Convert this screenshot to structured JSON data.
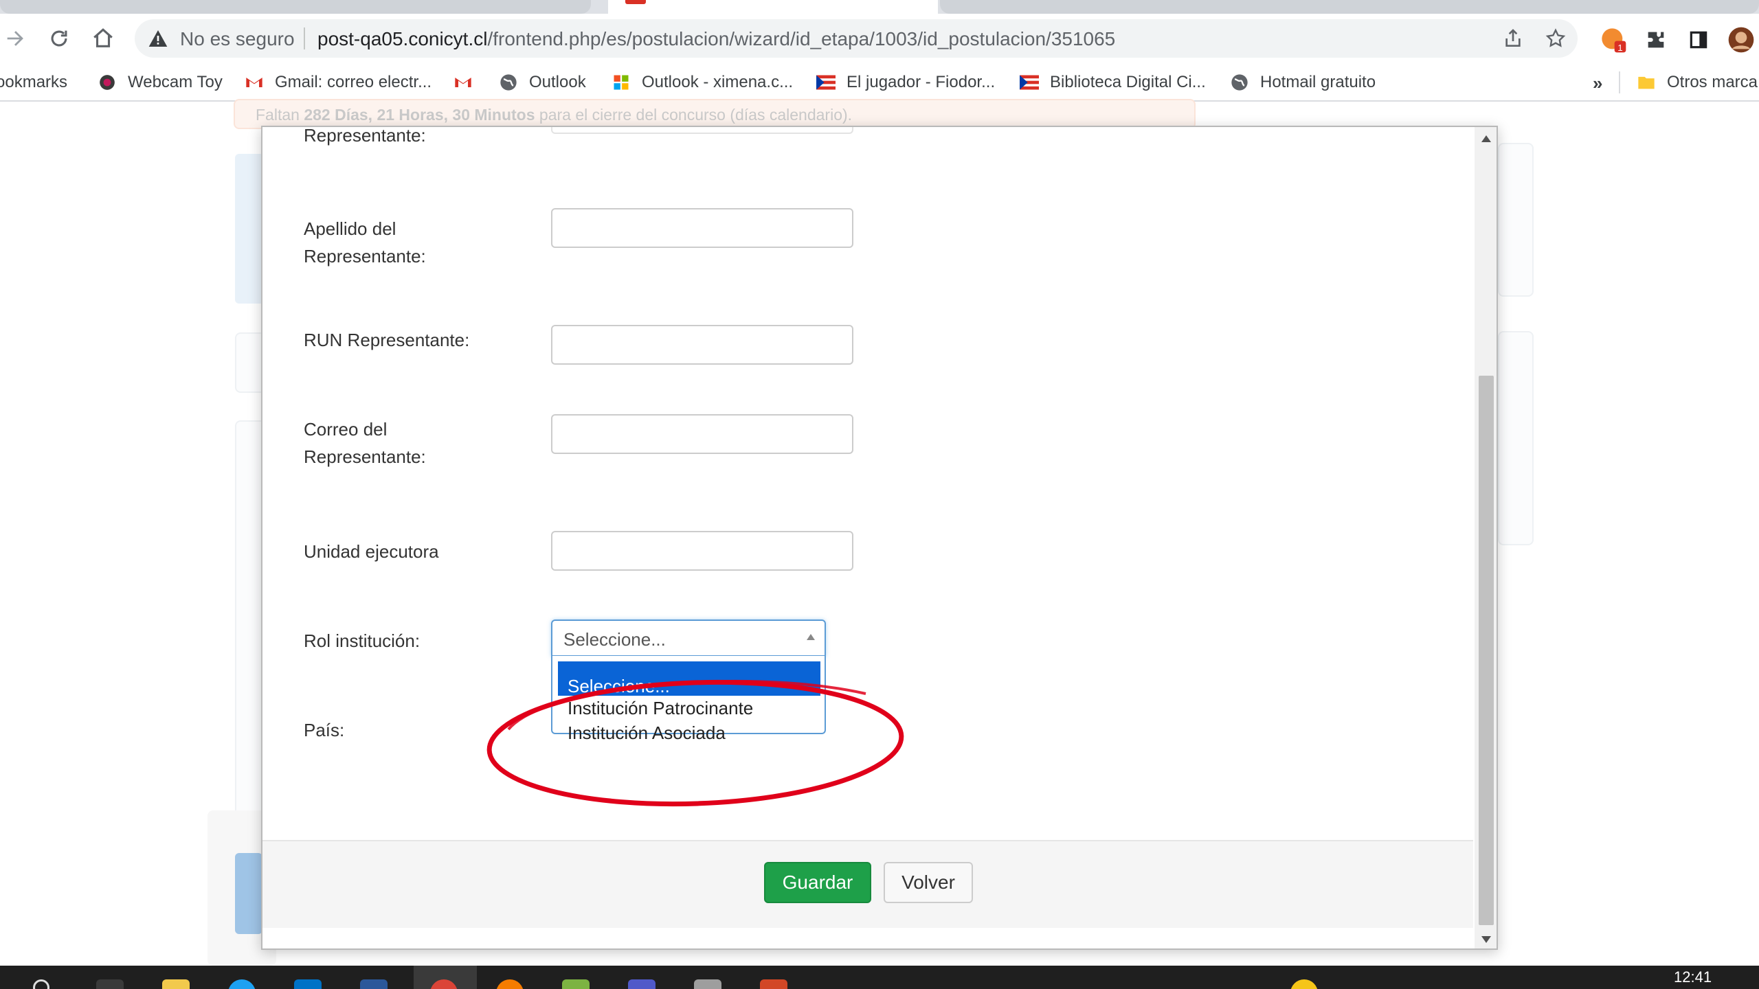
{
  "browser": {
    "url_host": "post-qa05.conicyt.cl",
    "url_path": "/frontend.php/es/postulacion/wizard/id_etapa/1003/id_postulacion/351065",
    "security_label": "No es seguro",
    "extension_badge": "1"
  },
  "bookmarks": {
    "items": [
      {
        "label": "ookmarks",
        "icon": "bookmarks-icon"
      },
      {
        "label": "Webcam Toy",
        "icon": "webcam-toy-icon"
      },
      {
        "label": "Gmail: correo electr...",
        "icon": "gmail-icon"
      },
      {
        "label": "",
        "icon": "gmail-icon"
      },
      {
        "label": "Outlook",
        "icon": "globe-icon"
      },
      {
        "label": "Outlook - ximena.c...",
        "icon": "windows-icon"
      },
      {
        "label": "El jugador - Fiodor...",
        "icon": "flag-icon"
      },
      {
        "label": "Biblioteca Digital Ci...",
        "icon": "flag-icon"
      },
      {
        "label": "Hotmail gratuito",
        "icon": "globe-icon"
      }
    ],
    "more": "»",
    "other": "Otros marca"
  },
  "page": {
    "deadline_prefix": "Faltan ",
    "deadline_bold": "282 Días, 21 Horas, 30 Minutos",
    "deadline_suffix": " para el cierre del concurso (días calendario)."
  },
  "modal": {
    "fields": {
      "top_cut_label": "Representante:",
      "apellido_label": "Apellido del Representante:",
      "run_label": "RUN Representante:",
      "correo_label": "Correo del Representante:",
      "unidad_label": "Unidad ejecutora",
      "rol_label": "Rol institución:",
      "pais_label": "País:"
    },
    "rol_select": {
      "value": "Seleccione...",
      "options": [
        "Seleccione...",
        "Institución Patrocinante",
        "Institución Asociada"
      ],
      "highlighted": "Seleccione..."
    },
    "buttons": {
      "save": "Guardar",
      "back": "Volver"
    }
  },
  "colors": {
    "save_button": "#1ea049",
    "select_highlight": "#0a64d6",
    "annotation": "#e0001a",
    "select_border": "#5b9bd5"
  },
  "taskbar": {
    "time": "12:41"
  }
}
